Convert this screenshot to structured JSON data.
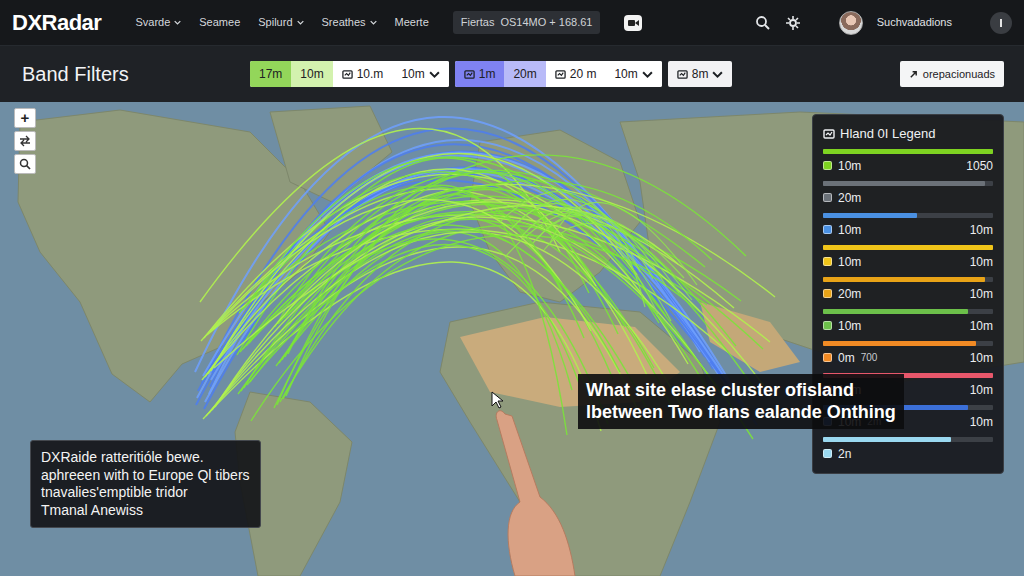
{
  "app": {
    "logo": "DXRadar"
  },
  "nav": [
    {
      "label": "Svarde",
      "dropdown": true
    },
    {
      "label": "Seamee",
      "dropdown": false
    },
    {
      "label": "Spilurd",
      "dropdown": true
    },
    {
      "label": "Sreathes",
      "dropdown": true
    },
    {
      "label": "Meerte",
      "dropdown": false
    }
  ],
  "frequency_box": {
    "label": "Fiertas",
    "value": "OS14MO + 168.61"
  },
  "user": {
    "name": "Suchvadadions"
  },
  "toolbar": {
    "title": "Band Filters",
    "groups": [
      {
        "buttons": [
          {
            "label": "17m",
            "kind": "chip",
            "color": "#93d65a"
          },
          {
            "label": "10m",
            "kind": "chip",
            "color": "#d3f2ae"
          },
          {
            "label": "10.m",
            "kind": "icon-chip",
            "color": "#ffffff"
          },
          {
            "label": "10m",
            "kind": "dropdown",
            "color": "#ffffff"
          }
        ]
      },
      {
        "buttons": [
          {
            "label": "1m",
            "kind": "icon-chip",
            "color": "#7f82f2"
          },
          {
            "label": "20m",
            "kind": "chip",
            "color": "#b8baf8"
          },
          {
            "label": "20 m",
            "kind": "icon-chip",
            "color": "#ffffff"
          },
          {
            "label": "10m",
            "kind": "dropdown",
            "color": "#ffffff"
          }
        ]
      },
      {
        "buttons": [
          {
            "label": "8m",
            "kind": "icon-dropdown",
            "color": "#f2f2f4"
          }
        ]
      }
    ],
    "action": "orepacionuads"
  },
  "map": {
    "zoom_in": "+"
  },
  "legend": {
    "title": "Hland 0I Legend",
    "items": [
      {
        "label": "10m",
        "value": "1050",
        "color": "#7ed321",
        "level": 1.0
      },
      {
        "label": "20m",
        "value": "",
        "color": "#6b7178",
        "level": 0.95
      },
      {
        "label": "10m",
        "value": "10m",
        "color": "#4a90e2",
        "level": 0.55
      },
      {
        "label": "10m",
        "value": "10m",
        "color": "#f0c419",
        "level": 1.0
      },
      {
        "label": "20m",
        "value": "10m",
        "color": "#e8a317",
        "level": 0.95
      },
      {
        "label": "10m",
        "value": "10m",
        "color": "#6cc04a",
        "level": 0.85
      },
      {
        "label": "0m",
        "note": "700",
        "value": "10m",
        "color": "#f08a24",
        "level": 0.9
      },
      {
        "label": "10m",
        "value": "10m",
        "color": "#e8576b",
        "level": 1.0
      },
      {
        "label": "10m",
        "note": "2m",
        "value": "10m",
        "color": "#3b6fd8",
        "level": 0.85
      },
      {
        "label": "2n",
        "value": "",
        "color": "#9ad8f0",
        "level": 0.75
      }
    ]
  },
  "notes": {
    "info_lines": [
      "DXRaide ratteritióle bewe.",
      "aphreeen with to Europe Ql tibers",
      "tnavalies'emptible tridor",
      "Tmanal Anewiss"
    ],
    "caption_lines": [
      "What site elase cluster ofisland",
      "lbetween Two flans ealande Onthing"
    ]
  }
}
